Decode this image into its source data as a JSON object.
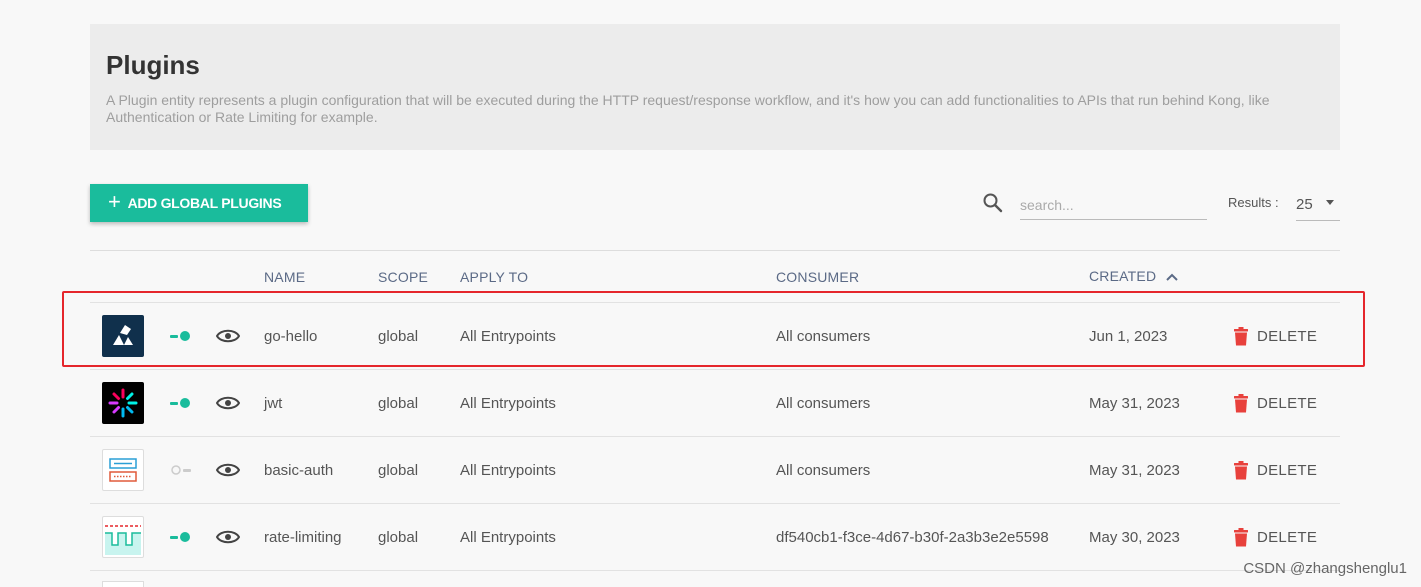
{
  "header": {
    "title": "Plugins",
    "description": "A Plugin entity represents a plugin configuration that will be executed during the HTTP request/response workflow, and it's how you can add functionalities to APIs that run behind Kong, like Authentication or Rate Limiting for example."
  },
  "toolbar": {
    "add_button_label": "ADD GLOBAL PLUGINS",
    "add_button_icon": "plus",
    "search_placeholder": "search...",
    "results_label": "Results :",
    "results_value": "25"
  },
  "table": {
    "columns": {
      "name": "NAME",
      "scope": "SCOPE",
      "apply_to": "APPLY TO",
      "consumer": "CONSUMER",
      "created": "CREATED"
    },
    "sort_direction": "ascending",
    "rows": [
      {
        "logo": "kong-logo-icon",
        "enabled": true,
        "name": "go-hello",
        "scope": "global",
        "apply_to": "All Entrypoints",
        "consumer": "All consumers",
        "consumer_is_link": false,
        "created": "Jun 1, 2023",
        "delete_label": "DELETE"
      },
      {
        "logo": "jwt-logo-icon",
        "enabled": true,
        "name": "jwt",
        "scope": "global",
        "apply_to": "All Entrypoints",
        "consumer": "All consumers",
        "consumer_is_link": false,
        "created": "May 31, 2023",
        "delete_label": "DELETE"
      },
      {
        "logo": "basic-auth-logo-icon",
        "enabled": false,
        "name": "basic-auth",
        "scope": "global",
        "apply_to": "All Entrypoints",
        "consumer": "All consumers",
        "consumer_is_link": false,
        "created": "May 31, 2023",
        "delete_label": "DELETE"
      },
      {
        "logo": "rate-limiting-logo-icon",
        "enabled": true,
        "name": "rate-limiting",
        "scope": "global",
        "apply_to": "All Entrypoints",
        "consumer": "df540cb1-f3ce-4d67-b30f-2a3b3e2e5598",
        "consumer_is_link": true,
        "created": "May 30, 2023",
        "delete_label": "DELETE"
      }
    ]
  },
  "watermark": "CSDN @zhangshenglu1",
  "colors": {
    "accent": "#1abc9c",
    "danger": "#e8413c",
    "link": "#2a8fd6",
    "highlight_border": "#e5262c"
  }
}
